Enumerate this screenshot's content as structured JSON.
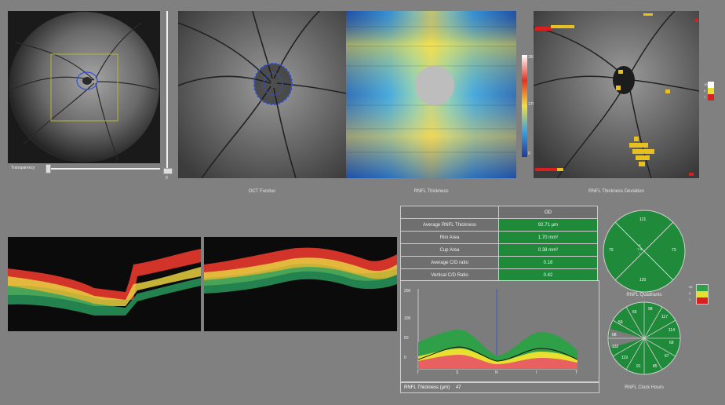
{
  "fundus_panel": {
    "transparency_label": "Transparency"
  },
  "vertical_slider": {
    "value_label": "0"
  },
  "captions": {
    "oct_fundus": "OCT Fundus",
    "rnfl_thickness": "RNFL Thickness",
    "rnfl_deviation": "RNFL Thickness Deviation",
    "rnfl_quadrants": "RNFL Quadrants",
    "rnfl_clock_hours": "RNFL Clock Hours"
  },
  "thickness_colorbar": {
    "ticks": [
      "350",
      "175",
      "0"
    ]
  },
  "deviation_legend": {
    "labels": [
      "100",
      "5",
      "1"
    ],
    "colors": [
      "#ffffff",
      "#e8e030",
      "#d82020"
    ]
  },
  "metrics_table": {
    "eye": "OD",
    "rows": [
      {
        "label": "Average RNFL Thickness",
        "value": "92.71 μm"
      },
      {
        "label": "Rim Area",
        "value": "1.70 mm²"
      },
      {
        "label": "Cup Area",
        "value": "0.38 mm²"
      },
      {
        "label": "Average C/D ratio",
        "value": "0.18"
      },
      {
        "label": "Vertical C/D Ratio",
        "value": "0.42"
      }
    ]
  },
  "quadrant_chart": {
    "values": {
      "superior": "121",
      "temporal": "70",
      "inferior": "120",
      "nasal": "73"
    },
    "center": [
      "S",
      "T N",
      "I"
    ]
  },
  "clock_chart": {
    "values": [
      "98",
      "117",
      "114",
      "69",
      "67",
      "85",
      "91",
      "119",
      "132",
      "68",
      "59",
      "65"
    ]
  },
  "profile_chart": {
    "yticks": [
      "200",
      "100",
      "50",
      "0"
    ],
    "xticks": [
      "T",
      "S",
      "N",
      "I",
      "T"
    ],
    "footer_label": "RNFL Thickness (μm)",
    "footer_value": "47"
  },
  "quadrant_legend": {
    "labels": [
      "95",
      "5",
      "1"
    ],
    "colors": [
      "#2fa047",
      "#e8e030",
      "#d82020"
    ]
  }
}
